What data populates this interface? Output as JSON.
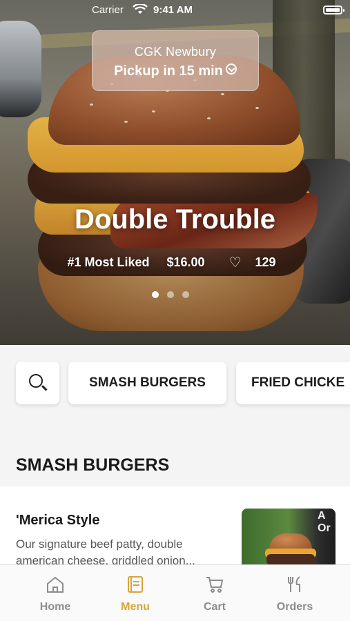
{
  "status_bar": {
    "carrier": "Carrier",
    "time": "9:41 AM"
  },
  "location": {
    "name": "CGK Newbury",
    "pickup": "Pickup in 15 min"
  },
  "hero": {
    "title": "Double Trouble",
    "rank": "#1 Most Liked",
    "price": "$16.00",
    "likes": "129",
    "slide_count": 3,
    "active_slide": 1
  },
  "categories": {
    "search_icon": "search-icon",
    "items": [
      "SMASH BURGERS",
      "FRIED CHICKE"
    ]
  },
  "section": {
    "title": "SMASH BURGERS"
  },
  "menu_item": {
    "name": "'Merica Style",
    "description": "Our signature beef patty, double american cheese, griddled onion...",
    "thumb_text": "A\nOr"
  },
  "tabs": [
    {
      "label": "Home",
      "icon": "home-icon"
    },
    {
      "label": "Menu",
      "icon": "menu-icon"
    },
    {
      "label": "Cart",
      "icon": "cart-icon"
    },
    {
      "label": "Orders",
      "icon": "orders-icon"
    }
  ],
  "colors": {
    "accent": "#d8a43a",
    "inactive": "#8c8c8c"
  }
}
